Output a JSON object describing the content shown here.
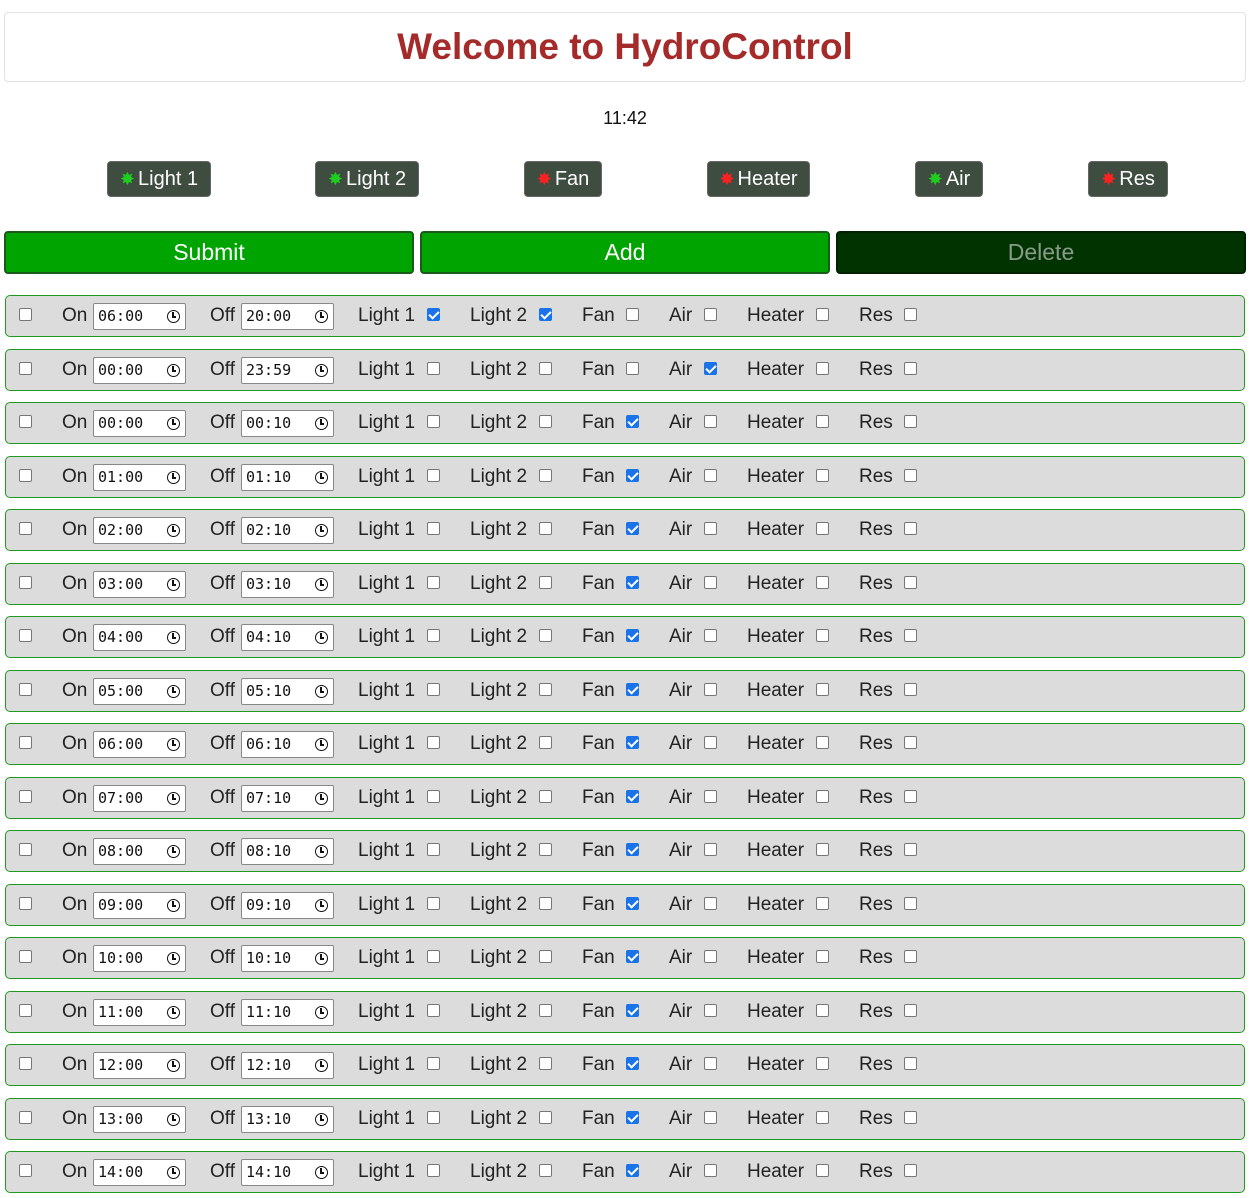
{
  "title": "Welcome to HydroControl",
  "time": "11:42",
  "status_buttons": [
    {
      "label": "Light 1",
      "state": "on"
    },
    {
      "label": "Light 2",
      "state": "on"
    },
    {
      "label": "Fan",
      "state": "off"
    },
    {
      "label": "Heater",
      "state": "off"
    },
    {
      "label": "Air",
      "state": "on"
    },
    {
      "label": "Res",
      "state": "off"
    }
  ],
  "actions": {
    "submit": "Submit",
    "add": "Add",
    "delete": "Delete"
  },
  "row_labels": {
    "on": "On",
    "off": "Off",
    "light1": "Light 1",
    "light2": "Light 2",
    "fan": "Fan",
    "air": "Air",
    "heater": "Heater",
    "res": "Res"
  },
  "colors": {
    "on_indicator": "#1fcc1f",
    "off_indicator": "#ff2020",
    "title": "#a52a2a",
    "accent_green": "#00a400"
  },
  "schedules": [
    {
      "selected": false,
      "on": "06:00",
      "off": "20:00",
      "light1": true,
      "light2": true,
      "fan": false,
      "air": false,
      "heater": false,
      "res": false
    },
    {
      "selected": false,
      "on": "00:00",
      "off": "23:59",
      "light1": false,
      "light2": false,
      "fan": false,
      "air": true,
      "heater": false,
      "res": false
    },
    {
      "selected": false,
      "on": "00:00",
      "off": "00:10",
      "light1": false,
      "light2": false,
      "fan": true,
      "air": false,
      "heater": false,
      "res": false
    },
    {
      "selected": false,
      "on": "01:00",
      "off": "01:10",
      "light1": false,
      "light2": false,
      "fan": true,
      "air": false,
      "heater": false,
      "res": false
    },
    {
      "selected": false,
      "on": "02:00",
      "off": "02:10",
      "light1": false,
      "light2": false,
      "fan": true,
      "air": false,
      "heater": false,
      "res": false
    },
    {
      "selected": false,
      "on": "03:00",
      "off": "03:10",
      "light1": false,
      "light2": false,
      "fan": true,
      "air": false,
      "heater": false,
      "res": false
    },
    {
      "selected": false,
      "on": "04:00",
      "off": "04:10",
      "light1": false,
      "light2": false,
      "fan": true,
      "air": false,
      "heater": false,
      "res": false
    },
    {
      "selected": false,
      "on": "05:00",
      "off": "05:10",
      "light1": false,
      "light2": false,
      "fan": true,
      "air": false,
      "heater": false,
      "res": false
    },
    {
      "selected": false,
      "on": "06:00",
      "off": "06:10",
      "light1": false,
      "light2": false,
      "fan": true,
      "air": false,
      "heater": false,
      "res": false
    },
    {
      "selected": false,
      "on": "07:00",
      "off": "07:10",
      "light1": false,
      "light2": false,
      "fan": true,
      "air": false,
      "heater": false,
      "res": false
    },
    {
      "selected": false,
      "on": "08:00",
      "off": "08:10",
      "light1": false,
      "light2": false,
      "fan": true,
      "air": false,
      "heater": false,
      "res": false
    },
    {
      "selected": false,
      "on": "09:00",
      "off": "09:10",
      "light1": false,
      "light2": false,
      "fan": true,
      "air": false,
      "heater": false,
      "res": false
    },
    {
      "selected": false,
      "on": "10:00",
      "off": "10:10",
      "light1": false,
      "light2": false,
      "fan": true,
      "air": false,
      "heater": false,
      "res": false
    },
    {
      "selected": false,
      "on": "11:00",
      "off": "11:10",
      "light1": false,
      "light2": false,
      "fan": true,
      "air": false,
      "heater": false,
      "res": false
    },
    {
      "selected": false,
      "on": "12:00",
      "off": "12:10",
      "light1": false,
      "light2": false,
      "fan": true,
      "air": false,
      "heater": false,
      "res": false
    },
    {
      "selected": false,
      "on": "13:00",
      "off": "13:10",
      "light1": false,
      "light2": false,
      "fan": true,
      "air": false,
      "heater": false,
      "res": false
    },
    {
      "selected": false,
      "on": "14:00",
      "off": "14:10",
      "light1": false,
      "light2": false,
      "fan": true,
      "air": false,
      "heater": false,
      "res": false
    }
  ]
}
